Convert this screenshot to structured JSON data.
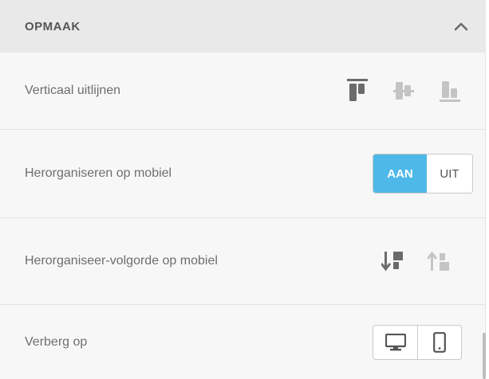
{
  "section": {
    "title": "OPMAAK",
    "collapse_icon": "chevron-up-icon"
  },
  "rows": {
    "vertical_align": {
      "label": "Verticaal uitlijnen",
      "options": [
        "align-top-icon",
        "align-middle-icon",
        "align-bottom-icon"
      ],
      "active": "align-top-icon"
    },
    "reorder_mobile": {
      "label": "Herorganiseren op mobiel",
      "on_label": "AAN",
      "off_label": "UIT",
      "value": "AAN"
    },
    "reorder_order": {
      "label": "Herorganiseer-volgorde op mobiel",
      "options": [
        "sort-down-icon",
        "sort-up-icon"
      ],
      "active": "sort-down-icon"
    },
    "hide_on": {
      "label": "Verberg op",
      "options": [
        "desktop-icon",
        "mobile-icon"
      ]
    }
  },
  "colors": {
    "accent": "#4eb8e8",
    "active_icon": "#6b6b6b",
    "inactive_icon": "#c4c4c4",
    "header_bg": "#e9e9e9",
    "panel_bg": "#f7f7f7"
  }
}
